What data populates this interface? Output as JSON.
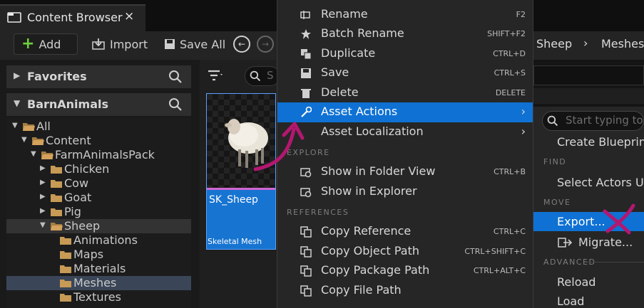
{
  "tab": {
    "title": "Content Browser",
    "close": "×",
    "icon": "content-browser-icon"
  },
  "toolbar": {
    "add_label": "Add",
    "import_label": "Import",
    "save_all_label": "Save All"
  },
  "breadcrumb": {
    "items": [
      "Sheep",
      "Meshes"
    ],
    "separator": "›"
  },
  "left_panel": {
    "favorites_label": "Favorites",
    "project_label": "BarnAnimals",
    "tree": [
      {
        "label": "All",
        "depth": 0,
        "expanded": true
      },
      {
        "label": "Content",
        "depth": 1,
        "expanded": true
      },
      {
        "label": "FarmAnimalsPack",
        "depth": 2,
        "expanded": true
      },
      {
        "label": "Chicken",
        "depth": 3,
        "expanded": false
      },
      {
        "label": "Cow",
        "depth": 3,
        "expanded": false
      },
      {
        "label": "Goat",
        "depth": 3,
        "expanded": false
      },
      {
        "label": "Pig",
        "depth": 3,
        "expanded": false
      },
      {
        "label": "Sheep",
        "depth": 3,
        "expanded": true
      },
      {
        "label": "Animations",
        "depth": 4
      },
      {
        "label": "Maps",
        "depth": 4
      },
      {
        "label": "Materials",
        "depth": 4
      },
      {
        "label": "Meshes",
        "depth": 4,
        "selected": true
      },
      {
        "label": "Textures",
        "depth": 4
      }
    ]
  },
  "assets": {
    "search_placeholder": "S",
    "card": {
      "name": "SK_Sheep",
      "type": "Skeletal Mesh"
    }
  },
  "context_menu": {
    "items": [
      {
        "label": "Rename",
        "shortcut": "F2",
        "icon": "rename-icon"
      },
      {
        "label": "Batch Rename",
        "shortcut": "SHIFT+F2",
        "icon": "batch-rename-icon"
      },
      {
        "label": "Duplicate",
        "shortcut": "CTRL+D",
        "icon": "duplicate-icon"
      },
      {
        "label": "Save",
        "shortcut": "CTRL+S",
        "icon": "save-icon"
      },
      {
        "label": "Delete",
        "shortcut": "DELETE",
        "icon": "delete-icon"
      },
      {
        "label": "Asset Actions",
        "shortcut": "›",
        "icon": "wrench-icon",
        "highlighted": true
      },
      {
        "label": "Asset Localization",
        "shortcut": "›",
        "icon": ""
      },
      {
        "label": "Show in Folder View",
        "shortcut": "CTRL+B",
        "icon": "folder-view-icon"
      },
      {
        "label": "Show in Explorer",
        "shortcut": "",
        "icon": "explorer-icon"
      },
      {
        "label": "Copy Reference",
        "shortcut": "CTRL+C",
        "icon": "copy-icon"
      },
      {
        "label": "Copy Object Path",
        "shortcut": "CTRL+SHIFT+C",
        "icon": "copy-icon"
      },
      {
        "label": "Copy Package Path",
        "shortcut": "CTRL+ALT+C",
        "icon": "copy-icon"
      },
      {
        "label": "Copy File Path",
        "shortcut": "",
        "icon": "copy-icon"
      }
    ],
    "sections": {
      "explore": "EXPLORE",
      "references": "REFERENCES"
    }
  },
  "submenu": {
    "search_placeholder": "Start typing to",
    "create_blueprint": "Create Blueprint",
    "find_section": "FIND",
    "select_actors": "Select Actors Us",
    "move_section": "MOVE",
    "export": "Export...",
    "migrate": "Migrate...",
    "advanced_section": "ADVANCED",
    "reload": "Reload",
    "load": "Load"
  },
  "annotations": {
    "arrow_color": "#b3176f",
    "cross_color": "#b3176f"
  },
  "colors": {
    "accent": "#0f71d3",
    "folder": "#c79a55"
  }
}
